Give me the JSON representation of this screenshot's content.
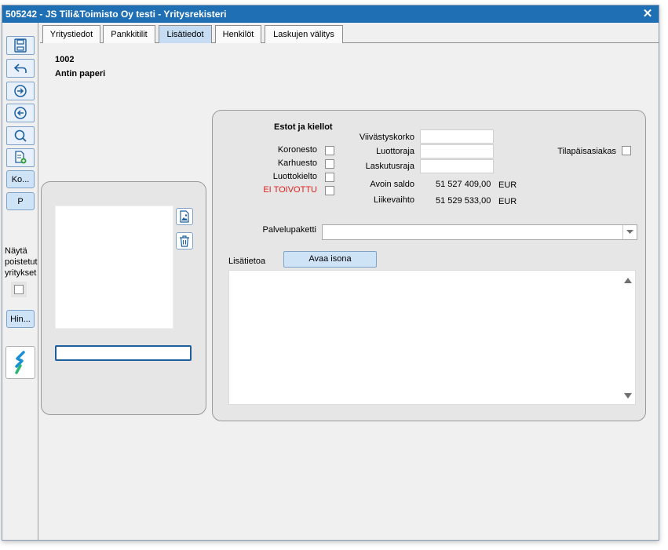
{
  "window": {
    "title": "505242 - JS Tili&Toimisto Oy testi - Yritysrekisteri",
    "close_glyph": "✕"
  },
  "toolbar": {
    "icons": [
      "save-icon",
      "undo-icon",
      "next-icon",
      "previous-icon",
      "search-icon",
      "new-document-icon"
    ],
    "ko_label": "Ko...",
    "p_label": "P",
    "show_deleted_lines": [
      "Näytä",
      "poistetut",
      "yritykset"
    ],
    "hin_label": "Hin..."
  },
  "tabs": [
    {
      "label": "Yritystiedot",
      "active": false
    },
    {
      "label": "Pankkitilit",
      "active": false
    },
    {
      "label": "Lisätiedot",
      "active": true
    },
    {
      "label": "Henkilöt",
      "active": false
    },
    {
      "label": "Laskujen välitys",
      "active": false
    }
  ],
  "company": {
    "number": "1002",
    "name": "Antin paperi"
  },
  "restrictions": {
    "heading": "Estot ja kiellot",
    "items": [
      {
        "label": "Koronesto",
        "checked": false,
        "color": "#000000"
      },
      {
        "label": "Karhuesto",
        "checked": false,
        "color": "#000000"
      },
      {
        "label": "Luottokielto",
        "checked": false,
        "color": "#000000"
      },
      {
        "label": "EI TOIVOTTU",
        "checked": false,
        "color": "#e02020"
      }
    ]
  },
  "finance": {
    "viivastyskorko_label": "Viivästyskorko",
    "viivastyskorko_value": "",
    "luottoraja_label": "Luottoraja",
    "luottoraja_value": "",
    "laskutusraja_label": "Laskutusraja",
    "laskutusraja_value": "",
    "avoin_saldo_label": "Avoin saldo",
    "avoin_saldo_value": "51 527 409,00",
    "liikevaihto_label": "Liikevaihto",
    "liikevaihto_value": "51 529 533,00",
    "currency": "EUR"
  },
  "temporary_customer": {
    "label": "Tilapäisasiakas",
    "checked": false
  },
  "service_package": {
    "label": "Palvelupaketti",
    "value": ""
  },
  "notes": {
    "label": "Lisätietoa",
    "open_large_label": "Avaa isona",
    "value": ""
  },
  "image_caption_value": ""
}
